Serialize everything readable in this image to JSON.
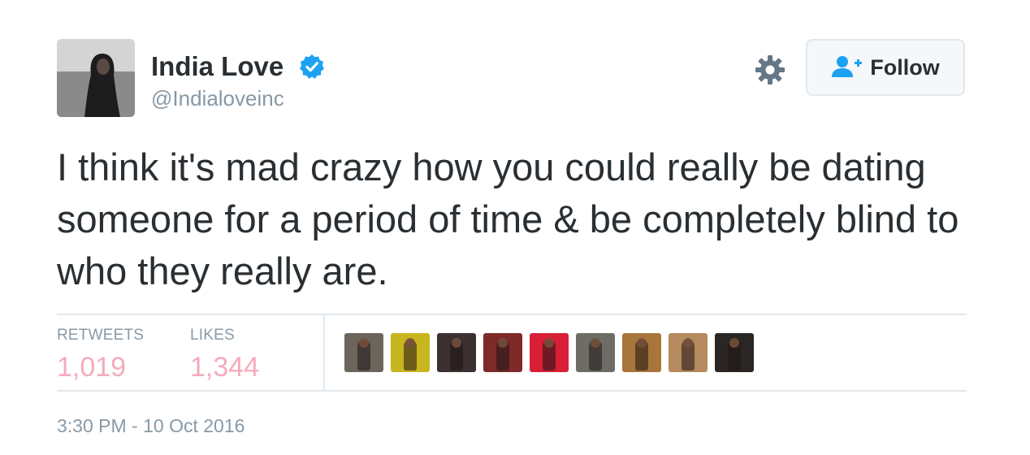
{
  "author": {
    "name": "India Love",
    "handle": "@Indialoveinc",
    "verified": true,
    "avatar_icon": "profile-photo"
  },
  "actions": {
    "settings_icon": "gear-icon",
    "follow_icon": "add-user-icon",
    "follow_label": "Follow"
  },
  "tweet": {
    "text": "I think it's mad crazy how you could really be dating someone for a period of time & be completely blind to who they really are."
  },
  "stats": {
    "retweets_label": "RETWEETS",
    "retweets_value": "1,019",
    "likes_label": "LIKES",
    "likes_value": "1,344"
  },
  "likers": [
    {
      "color": "#6b655c"
    },
    {
      "color": "#c9b51f"
    },
    {
      "color": "#3d3030"
    },
    {
      "color": "#7e2a2a"
    },
    {
      "color": "#d81f36"
    },
    {
      "color": "#6d6d66"
    },
    {
      "color": "#a8763a"
    },
    {
      "color": "#b48a5e"
    },
    {
      "color": "#2a2623"
    }
  ],
  "timestamp": "3:30 PM - 10 Oct 2016",
  "colors": {
    "text": "#292f33",
    "muted": "#8899a6",
    "stat_value": "#f4abbd",
    "verified": "#1da1f2",
    "border": "#e1e8ed"
  }
}
